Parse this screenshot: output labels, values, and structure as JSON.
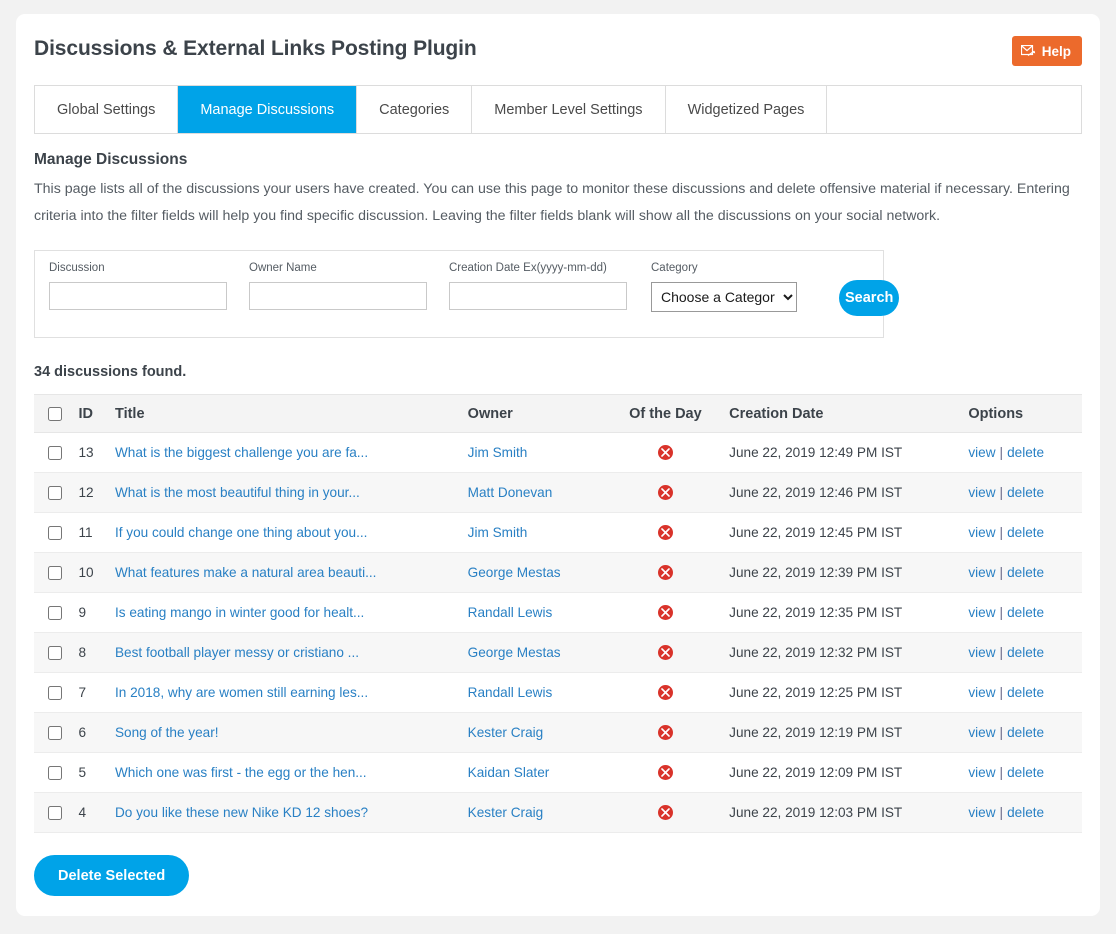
{
  "header": {
    "title": "Discussions & External Links Posting Plugin",
    "help_label": "Help",
    "help_icon": "envelope-arrow-icon",
    "help_color": "#ec6a2c"
  },
  "accent_color": "#00a3e8",
  "tabs": [
    {
      "label": "Global Settings",
      "active": false
    },
    {
      "label": "Manage Discussions",
      "active": true
    },
    {
      "label": "Categories",
      "active": false
    },
    {
      "label": "Member Level Settings",
      "active": false
    },
    {
      "label": "Widgetized Pages",
      "active": false
    }
  ],
  "section": {
    "title": "Manage Discussions",
    "description": "This page lists all of the discussions your users have created. You can use this page to monitor these discussions and delete offensive material if necessary. Entering criteria into the filter fields will help you find specific discussion. Leaving the filter fields blank will show all the discussions on your social network."
  },
  "filters": {
    "discussion": {
      "label": "Discussion",
      "value": "",
      "placeholder": ""
    },
    "owner": {
      "label": "Owner Name",
      "value": "",
      "placeholder": ""
    },
    "creation_date": {
      "label": "Creation Date Ex(yyyy-mm-dd)",
      "value": "",
      "placeholder": ""
    },
    "category": {
      "label": "Category",
      "selected": "Choose a Category",
      "options": [
        "Choose a Category"
      ]
    },
    "search_label": "Search"
  },
  "results": {
    "count_text": "34 discussions found.",
    "columns": {
      "id": "ID",
      "title": "Title",
      "owner": "Owner",
      "of_the_day": "Of the Day",
      "creation_date": "Creation Date",
      "options": "Options"
    },
    "option_labels": {
      "view": "view",
      "delete": "delete",
      "separator": "|"
    },
    "of_the_day_icon": "red-circle-x-icon",
    "rows": [
      {
        "id": "13",
        "title": "What is the biggest challenge you are fa...",
        "owner": "Jim Smith",
        "of_the_day": false,
        "date": "June 22, 2019 12:49 PM IST"
      },
      {
        "id": "12",
        "title": "What is the most beautiful thing in your...",
        "owner": "Matt Donevan",
        "of_the_day": false,
        "date": "June 22, 2019 12:46 PM IST"
      },
      {
        "id": "11",
        "title": "If you could change one thing about you...",
        "owner": "Jim Smith",
        "of_the_day": false,
        "date": "June 22, 2019 12:45 PM IST"
      },
      {
        "id": "10",
        "title": "What features make a natural area beauti...",
        "owner": "George Mestas",
        "of_the_day": false,
        "date": "June 22, 2019 12:39 PM IST"
      },
      {
        "id": "9",
        "title": "Is eating mango in winter good for healt...",
        "owner": "Randall Lewis",
        "of_the_day": false,
        "date": "June 22, 2019 12:35 PM IST"
      },
      {
        "id": "8",
        "title": "Best football player messy or cristiano ...",
        "owner": "George Mestas",
        "of_the_day": false,
        "date": "June 22, 2019 12:32 PM IST"
      },
      {
        "id": "7",
        "title": "In 2018, why are women still earning les...",
        "owner": "Randall Lewis",
        "of_the_day": false,
        "date": "June 22, 2019 12:25 PM IST"
      },
      {
        "id": "6",
        "title": "Song of the year!",
        "owner": "Kester Craig",
        "of_the_day": false,
        "date": "June 22, 2019 12:19 PM IST"
      },
      {
        "id": "5",
        "title": "Which one was first - the egg or the hen...",
        "owner": "Kaidan Slater",
        "of_the_day": false,
        "date": "June 22, 2019 12:09 PM IST"
      },
      {
        "id": "4",
        "title": "Do you like these new Nike KD 12 shoes?",
        "owner": "Kester Craig",
        "of_the_day": false,
        "date": "June 22, 2019 12:03 PM IST"
      }
    ]
  },
  "footer": {
    "delete_selected_label": "Delete Selected"
  }
}
